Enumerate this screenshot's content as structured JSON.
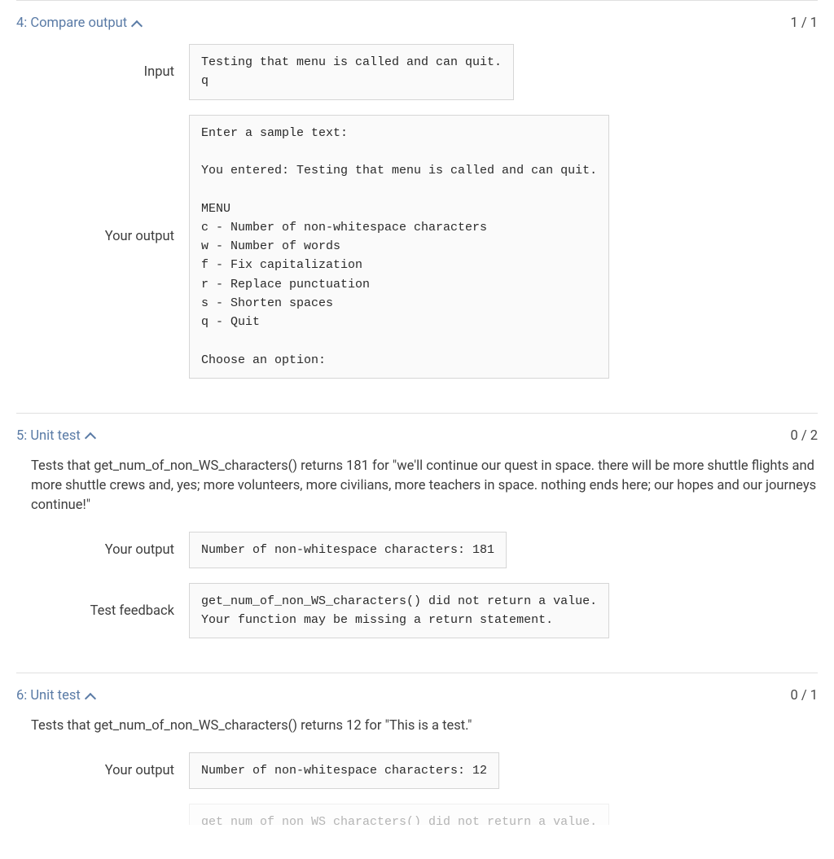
{
  "tests": [
    {
      "number": "4",
      "title": "Compare output",
      "score": "1 / 1",
      "description": "",
      "rows": [
        {
          "label": "Input",
          "content": "Testing that menu is called and can quit.\nq",
          "narrow": true
        },
        {
          "label": "Your output",
          "content": "Enter a sample text:\n\nYou entered: Testing that menu is called and can quit.\n\nMENU\nc - Number of non-whitespace characters\nw - Number of words\nf - Fix capitalization\nr - Replace punctuation\ns - Shorten spaces\nq - Quit\n\nChoose an option:",
          "narrow": false
        }
      ]
    },
    {
      "number": "5",
      "title": "Unit test",
      "score": "0 / 2",
      "description": "Tests that get_num_of_non_WS_characters() returns 181 for \"we'll continue our quest in space. there will be more shuttle flights and more shuttle crews and, yes; more volunteers, more civilians, more teachers in space. nothing ends here; our hopes and our journeys continue!\"",
      "rows": [
        {
          "label": "Your output",
          "content": "Number of non-whitespace characters: 181",
          "narrow": true
        },
        {
          "label": "Test feedback",
          "content": "get_num_of_non_WS_characters() did not return a value.\nYour function may be missing a return statement.",
          "narrow": false
        }
      ]
    },
    {
      "number": "6",
      "title": "Unit test",
      "score": "0 / 1",
      "description": "Tests that get_num_of_non_WS_characters() returns 12 for \"This is a test.\"",
      "rows": [
        {
          "label": "Your output",
          "content": "Number of non-whitespace characters: 12",
          "narrow": true
        },
        {
          "label": "",
          "content": "get_num_of_non_WS_characters() did not return a value.",
          "narrow": false,
          "cutoff": true
        }
      ]
    }
  ]
}
